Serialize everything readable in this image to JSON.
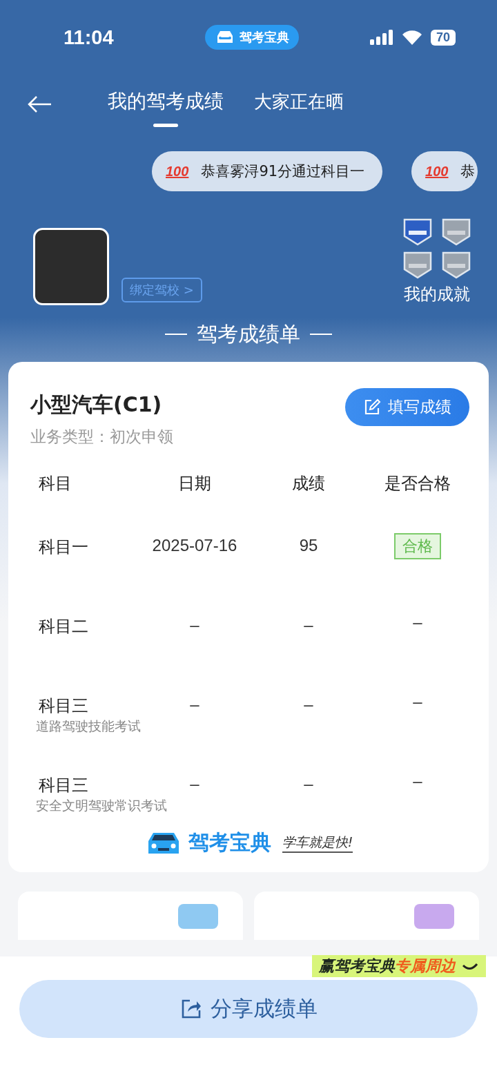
{
  "status_bar": {
    "time": "11:04",
    "app_badge": "驾考宝典",
    "battery": "70"
  },
  "nav": {
    "tabs": [
      {
        "label": "我的驾考成绩",
        "selected": true
      },
      {
        "label": "大家正在晒",
        "selected": false
      }
    ]
  },
  "ticker": [
    {
      "badge": "100",
      "text": "恭喜雾浔91分通过科目一"
    },
    {
      "badge": "100",
      "text": "恭"
    }
  ],
  "profile": {
    "bind_button": "绑定驾校 >",
    "achievements": {
      "label": "我的成就",
      "badges": [
        {
          "earned": true
        },
        {
          "earned": false
        },
        {
          "earned": false
        },
        {
          "earned": false
        }
      ]
    }
  },
  "section_title": "驾考成绩单",
  "score_card": {
    "vehicle": "小型汽车(C1)",
    "business_type": "业务类型：初次申领",
    "fill_button": "填写成绩",
    "columns": [
      "科目",
      "日期",
      "成绩",
      "是否合格"
    ],
    "rows": [
      {
        "subject": "科目一",
        "date": "2025-07-16",
        "score": "95",
        "result": {
          "kind": "badge",
          "text": "合格"
        }
      },
      {
        "subject": "科目二",
        "date": "–",
        "score": "–",
        "result": {
          "kind": "text",
          "text": "–"
        }
      },
      {
        "subject": "科目三",
        "note": "道路驾驶技能考试",
        "date": "–",
        "score": "–",
        "result": {
          "kind": "text",
          "text": "–"
        }
      },
      {
        "subject": "科目三",
        "note": "安全文明驾驶常识考试",
        "date": "–",
        "score": "–",
        "result": {
          "kind": "text",
          "text": "–"
        }
      }
    ],
    "logo": {
      "name": "驾考宝典",
      "slogan": "学车就是快!"
    }
  },
  "promo_sticker": {
    "text": "赢驾考宝典",
    "highlight": "专属周边"
  },
  "share_button": "分享成绩单"
}
